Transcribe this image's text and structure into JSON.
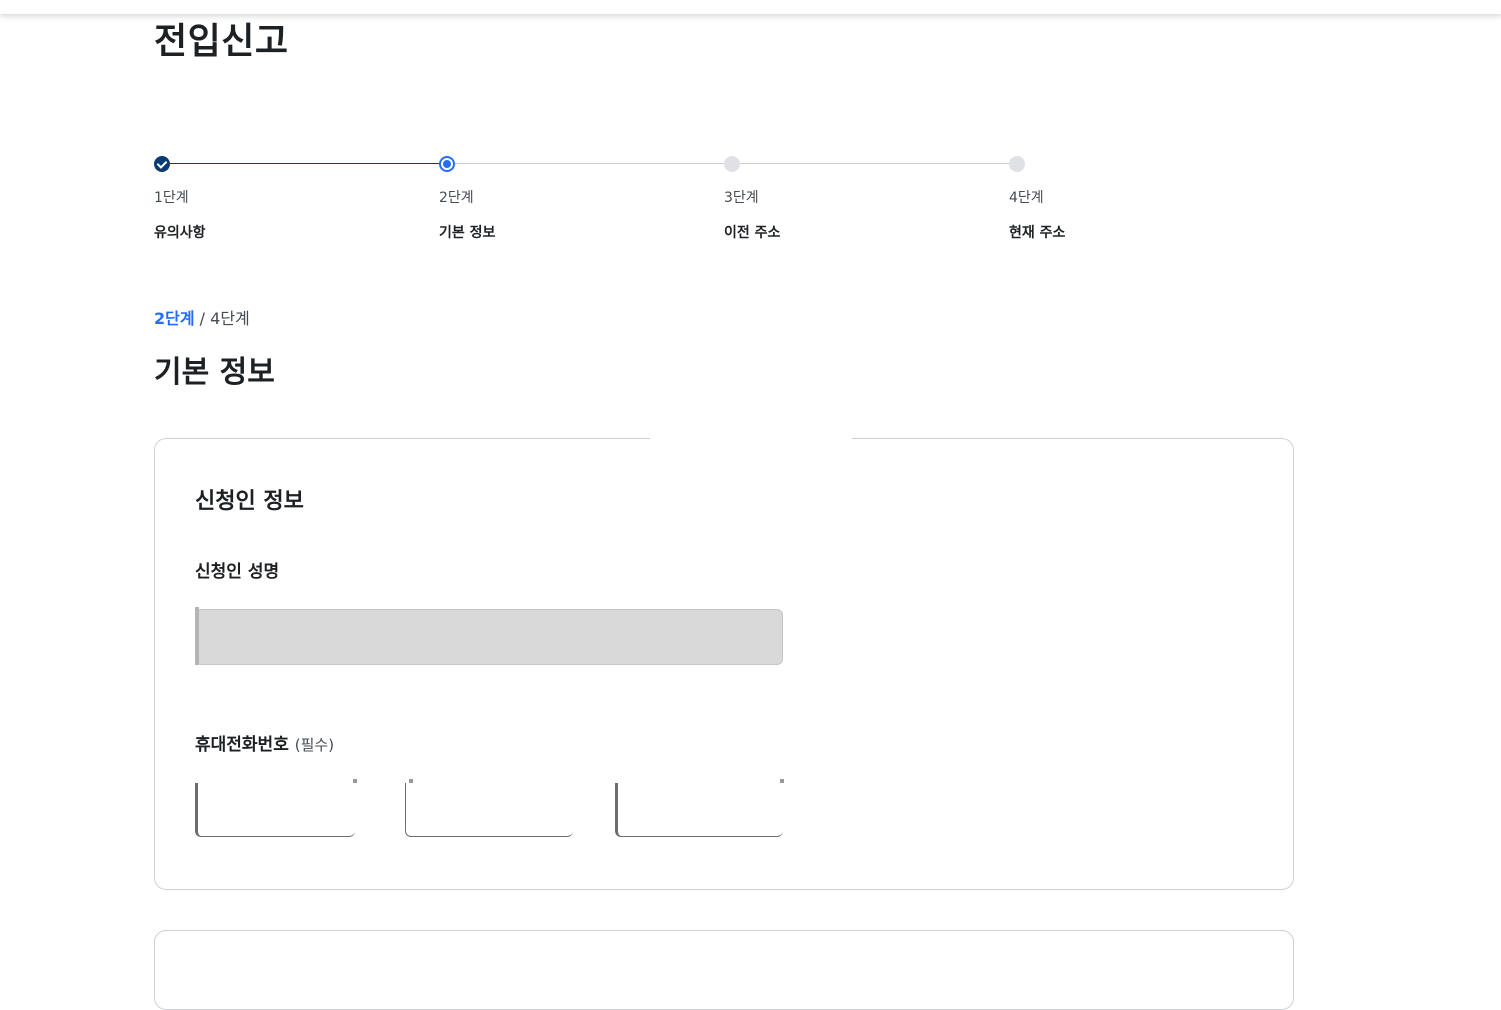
{
  "page": {
    "title": "전입신고"
  },
  "stepper": {
    "steps": [
      {
        "num": "1단계",
        "label": "유의사항",
        "state": "done"
      },
      {
        "num": "2단계",
        "label": "기본 정보",
        "state": "current"
      },
      {
        "num": "3단계",
        "label": "이전 주소",
        "state": "todo"
      },
      {
        "num": "4단계",
        "label": "현재 주소",
        "state": "todo"
      }
    ]
  },
  "progress": {
    "current": "2단계",
    "separator": " / ",
    "total": "4단계"
  },
  "section": {
    "title": "기본 정보"
  },
  "applicant": {
    "card_title": "신청인 정보",
    "name_label": "신청인 성명",
    "name_value": "",
    "phone_label": "휴대전화번호",
    "phone_required": "(필수)",
    "phone_parts": [
      "",
      "",
      ""
    ]
  },
  "colors": {
    "primary": "#256ef4",
    "done": "#0b3b75",
    "border": "#cdd1d5",
    "disabled_input": "#d9d9d9"
  }
}
